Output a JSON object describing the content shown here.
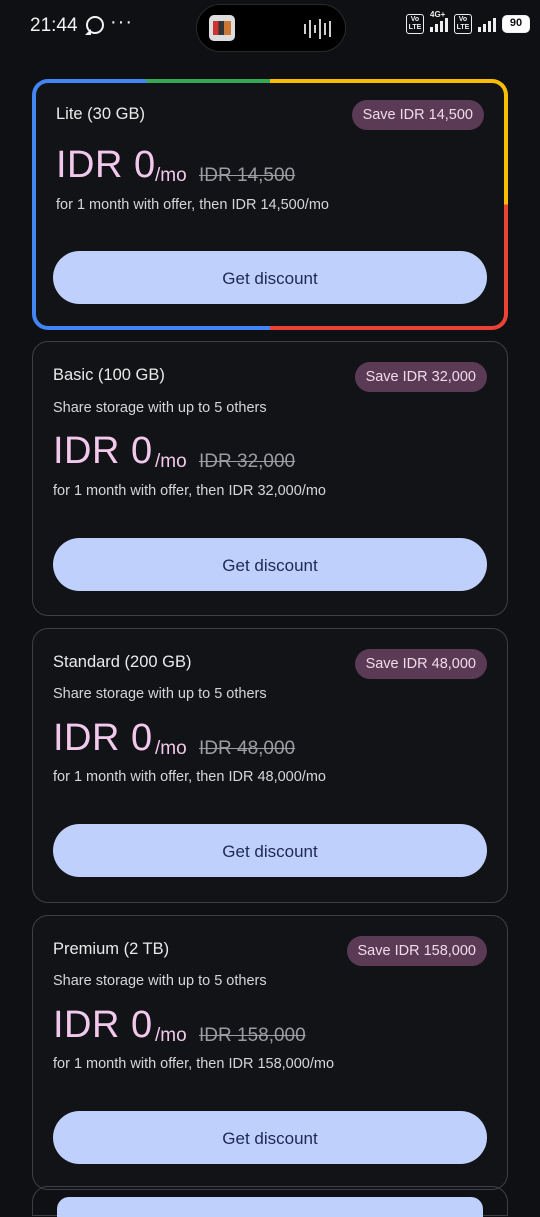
{
  "status_bar": {
    "time": "21:44",
    "network_label": "4G+",
    "volte_label": "Vo LTE",
    "battery": "90",
    "icons": [
      "whatsapp-icon",
      "more-dots-icon",
      "volte-icon",
      "signal-icon",
      "battery-icon"
    ]
  },
  "plans": [
    {
      "name": "Lite (30 GB)",
      "save": "Save IDR 14,500",
      "share": "",
      "price": "IDR 0",
      "per": "/mo",
      "old_price": "IDR 14,500",
      "terms": "for 1 month with offer, then IDR 14,500/mo",
      "cta": "Get discount"
    },
    {
      "name": "Basic (100 GB)",
      "save": "Save IDR 32,000",
      "share": "Share storage with up to 5 others",
      "price": "IDR 0",
      "per": "/mo",
      "old_price": "IDR 32,000",
      "terms": "for 1 month with offer, then IDR 32,000/mo",
      "cta": "Get discount"
    },
    {
      "name": "Standard (200 GB)",
      "save": "Save IDR 48,000",
      "share": "Share storage with up to 5 others",
      "price": "IDR 0",
      "per": "/mo",
      "old_price": "IDR 48,000",
      "terms": "for 1 month with offer, then IDR 48,000/mo",
      "cta": "Get discount"
    },
    {
      "name": "Premium (2 TB)",
      "save": "Save IDR 158,000",
      "share": "Share storage with up to 5 others",
      "price": "IDR 0",
      "per": "/mo",
      "old_price": "IDR 158,000",
      "terms": "for 1 month with offer, then IDR 158,000/mo",
      "cta": "Get discount"
    }
  ],
  "colors": {
    "background": "#0f1013",
    "price": "#f2c8ec",
    "badge": "#5a3a55",
    "button": "#c0d0fc",
    "button_text": "#1b2a52"
  }
}
